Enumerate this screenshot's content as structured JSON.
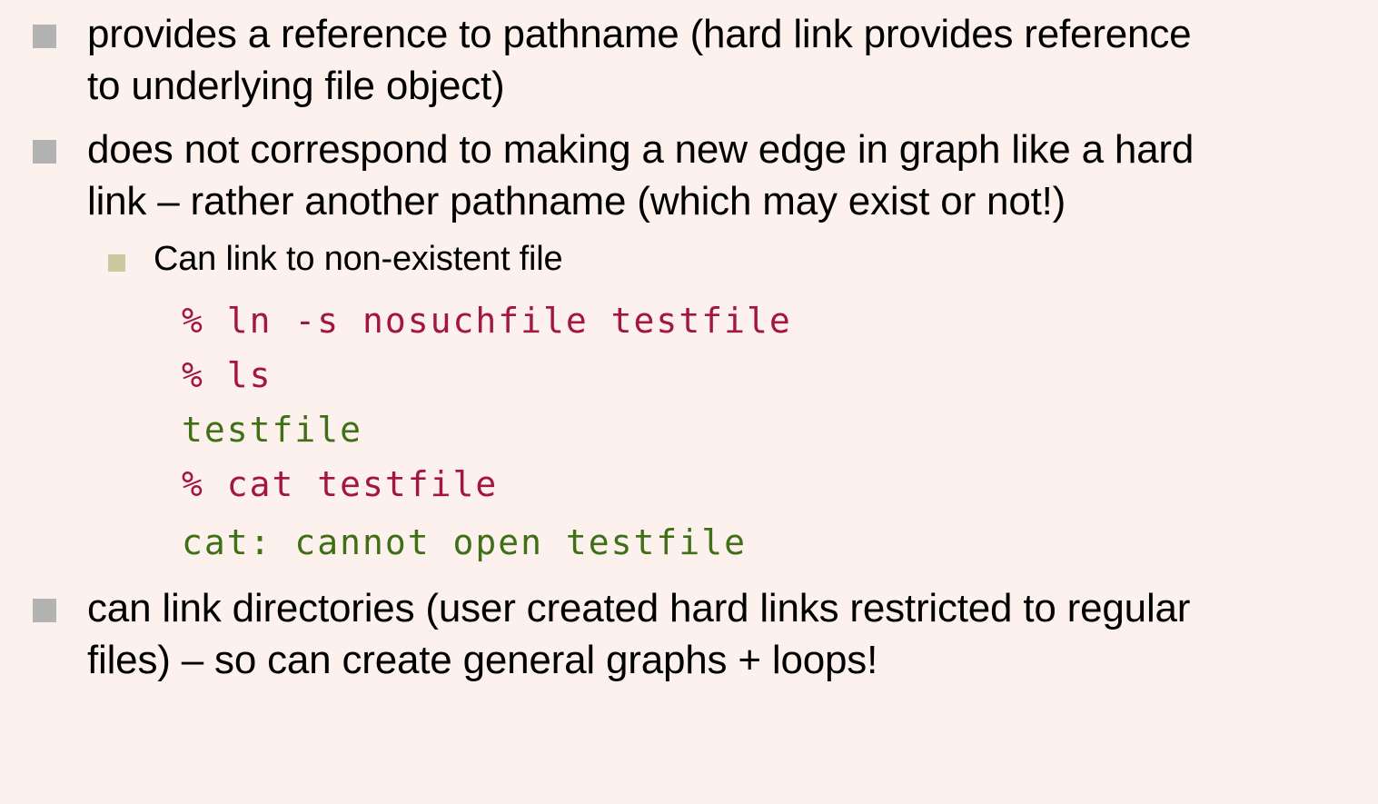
{
  "slide": {
    "bullets": [
      {
        "line1": "provides a reference to pathname (hard link provides reference",
        "line2": "to underlying file object)"
      },
      {
        "line1": "does not correspond to making a new edge in graph like a hard",
        "line2": "link – rather another pathname (which may exist or not!)"
      },
      {
        "line1": "can link directories (user created hard links restricted to regular",
        "line2": "files) – so can create general graphs + loops!"
      }
    ],
    "sub_bullet": "Can link to non-existent file",
    "code": [
      "% ln -s nosuchfile testfile",
      "% ls",
      "testfile",
      "% cat testfile",
      "cat: cannot open testfile"
    ]
  },
  "colors": {
    "background": "#fcf1ec",
    "bullet_marker": "#b3b3b3",
    "sub_bullet_marker": "#c9caa0",
    "command_text": "#a3163e",
    "output_text": "#3f6f16"
  }
}
